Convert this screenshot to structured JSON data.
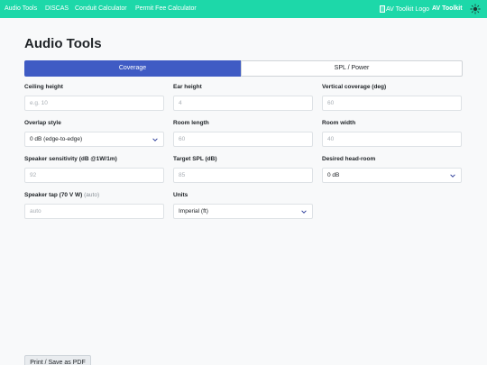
{
  "nav": {
    "links": [
      "Audio Tools",
      "DISCAS",
      "Conduit Calculator",
      "Permit Fee Calculator"
    ],
    "logo_alt": "AV Toolkit Logo",
    "brand": "AV Toolkit",
    "theme_icon": "sun-icon",
    "bar_color": "#1dd8a9"
  },
  "page": {
    "title": "Audio Tools"
  },
  "tabs": [
    {
      "label": "Coverage",
      "active": true
    },
    {
      "label": "SPL / Power",
      "active": false
    }
  ],
  "form": {
    "ceiling_height": {
      "label": "Ceiling height",
      "placeholder": "e.g. 10"
    },
    "ear_height": {
      "label": "Ear height",
      "placeholder": "4"
    },
    "vertical_coverage": {
      "label": "Vertical coverage (deg)",
      "placeholder": "60"
    },
    "overlap_style": {
      "label": "Overlap style",
      "value": "0 dB (edge-to-edge)"
    },
    "room_length": {
      "label": "Room length",
      "placeholder": "60"
    },
    "room_width": {
      "label": "Room width",
      "placeholder": "40"
    },
    "speaker_sensitivity": {
      "label": "Speaker sensitivity (dB @1W/1m)",
      "placeholder": "92"
    },
    "target_spl": {
      "label": "Target SPL (dB)",
      "placeholder": "85"
    },
    "headroom": {
      "label": "Desired head-room",
      "value": "0 dB"
    },
    "speaker_tap": {
      "label": "Speaker tap (70 V W)",
      "label_note": "(auto)",
      "placeholder": "auto"
    },
    "units": {
      "label": "Units",
      "value": "Imperial (ft)"
    }
  },
  "actions": {
    "print_label": "Print / Save as PDF"
  },
  "colors": {
    "accent": "#3f5bc4",
    "chevron": "#2d3e9a"
  }
}
